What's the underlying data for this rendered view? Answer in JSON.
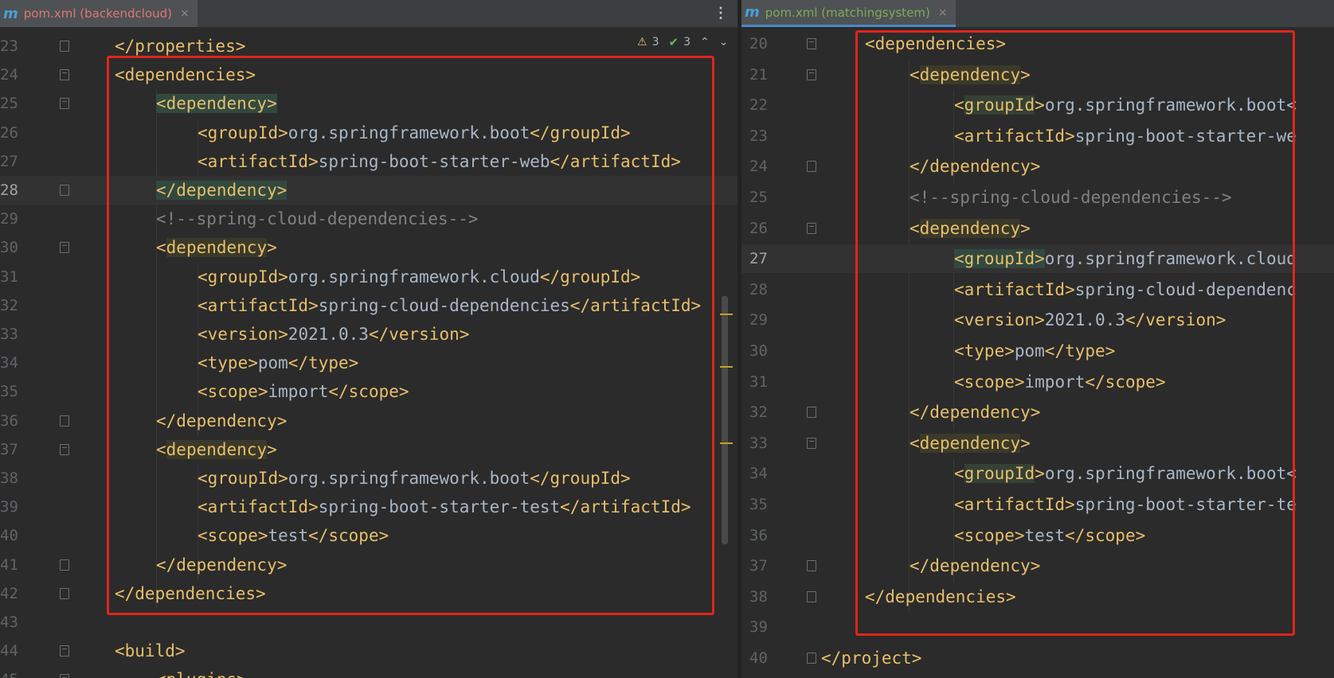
{
  "left": {
    "tab": {
      "icon": "maven-m-icon",
      "glyph": "m",
      "label": "pom.xml (backendcloud)",
      "close": "×"
    },
    "more_glyph": "⋮",
    "indicators": {
      "warning_icon": "⚠",
      "warnings": "3",
      "ok_icon": "✔",
      "ok": "3",
      "up": "⌃",
      "down": "⌄"
    },
    "lines": [
      {
        "n": "23",
        "code": [
          {
            "t": "</properties>",
            "c": "tag"
          }
        ]
      },
      {
        "n": "24",
        "code": [
          {
            "t": "<dependencies>",
            "c": "tag"
          }
        ]
      },
      {
        "n": "25",
        "code": [
          {
            "t": "<dependency>",
            "c": "tag hl-teal"
          }
        ]
      },
      {
        "n": "26",
        "code": [
          {
            "t": "<groupId>",
            "c": "tag"
          },
          {
            "t": "org.springframework.boot",
            "c": "txt"
          },
          {
            "t": "</groupId>",
            "c": "tag"
          }
        ]
      },
      {
        "n": "27",
        "code": [
          {
            "t": "<artifactId>",
            "c": "tag"
          },
          {
            "t": "spring-boot-starter-web",
            "c": "txt"
          },
          {
            "t": "</artifactId>",
            "c": "tag"
          }
        ]
      },
      {
        "n": "28",
        "code": [
          {
            "t": "</dependency>",
            "c": "tag hl-teal"
          }
        ]
      },
      {
        "n": "29",
        "code": [
          {
            "t": "<!--spring-cloud-dependencies-->",
            "c": "cmt"
          }
        ]
      },
      {
        "n": "30",
        "code": [
          {
            "t": "<",
            "c": "tag"
          },
          {
            "t": "dependency",
            "c": "tag hl-olive"
          },
          {
            "t": ">",
            "c": "tag"
          }
        ]
      },
      {
        "n": "31",
        "code": [
          {
            "t": "<groupId>",
            "c": "tag"
          },
          {
            "t": "org.springframework.cloud",
            "c": "txt"
          },
          {
            "t": "</groupId>",
            "c": "tag"
          }
        ]
      },
      {
        "n": "32",
        "code": [
          {
            "t": "<artifactId>",
            "c": "tag"
          },
          {
            "t": "spring-cloud-dependencies",
            "c": "txt"
          },
          {
            "t": "</artifactId>",
            "c": "tag"
          }
        ]
      },
      {
        "n": "33",
        "code": [
          {
            "t": "<version>",
            "c": "tag"
          },
          {
            "t": "2021.0.3",
            "c": "txt"
          },
          {
            "t": "</version>",
            "c": "tag"
          }
        ]
      },
      {
        "n": "34",
        "code": [
          {
            "t": "<type>",
            "c": "tag"
          },
          {
            "t": "pom",
            "c": "txt"
          },
          {
            "t": "</type>",
            "c": "tag"
          }
        ]
      },
      {
        "n": "35",
        "code": [
          {
            "t": "<scope>",
            "c": "tag"
          },
          {
            "t": "import",
            "c": "txt"
          },
          {
            "t": "</scope>",
            "c": "tag"
          }
        ]
      },
      {
        "n": "36",
        "code": [
          {
            "t": "</dependency>",
            "c": "tag"
          }
        ]
      },
      {
        "n": "37",
        "code": [
          {
            "t": "<",
            "c": "tag"
          },
          {
            "t": "dependency",
            "c": "tag hl-olive"
          },
          {
            "t": ">",
            "c": "tag"
          }
        ]
      },
      {
        "n": "38",
        "code": [
          {
            "t": "<groupId>",
            "c": "tag"
          },
          {
            "t": "org.springframework.boot",
            "c": "txt"
          },
          {
            "t": "</groupId>",
            "c": "tag"
          }
        ]
      },
      {
        "n": "39",
        "code": [
          {
            "t": "<artifactId>",
            "c": "tag"
          },
          {
            "t": "spring-boot-starter-test",
            "c": "txt"
          },
          {
            "t": "</artifactId>",
            "c": "tag"
          }
        ]
      },
      {
        "n": "40",
        "code": [
          {
            "t": "<scope>",
            "c": "tag"
          },
          {
            "t": "test",
            "c": "txt"
          },
          {
            "t": "</scope>",
            "c": "tag"
          }
        ]
      },
      {
        "n": "41",
        "code": [
          {
            "t": "</dependency>",
            "c": "tag"
          }
        ]
      },
      {
        "n": "42",
        "code": [
          {
            "t": "</dependencies>",
            "c": "tag"
          }
        ]
      },
      {
        "n": "43",
        "code": []
      },
      {
        "n": "44",
        "code": [
          {
            "t": "<build>",
            "c": "tag"
          }
        ]
      },
      {
        "n": "45",
        "code": [
          {
            "t": "<plugins>",
            "c": "tag"
          }
        ]
      }
    ]
  },
  "right": {
    "tab": {
      "icon": "maven-m-icon",
      "glyph": "m",
      "label": "pom.xml (matchingsystem)",
      "close": "×"
    },
    "lines": [
      {
        "n": "20",
        "code": [
          {
            "t": "<dependencies>",
            "c": "tag"
          }
        ]
      },
      {
        "n": "21",
        "code": [
          {
            "t": "<",
            "c": "tag"
          },
          {
            "t": "dependency",
            "c": "tag hl-olive"
          },
          {
            "t": ">",
            "c": "tag"
          }
        ]
      },
      {
        "n": "22",
        "code": [
          {
            "t": "<",
            "c": "tag"
          },
          {
            "t": "groupId",
            "c": "tag hl-green"
          },
          {
            "t": ">",
            "c": "tag"
          },
          {
            "t": "org.springframework.boot<",
            "c": "txt"
          }
        ]
      },
      {
        "n": "23",
        "code": [
          {
            "t": "<artifactId>",
            "c": "tag"
          },
          {
            "t": "spring-boot-starter-we",
            "c": "txt"
          }
        ]
      },
      {
        "n": "24",
        "code": [
          {
            "t": "</dependency>",
            "c": "tag"
          }
        ]
      },
      {
        "n": "25",
        "code": [
          {
            "t": "<!--spring-cloud-dependencies-->",
            "c": "cmt"
          }
        ]
      },
      {
        "n": "26",
        "code": [
          {
            "t": "<",
            "c": "tag"
          },
          {
            "t": "dependency",
            "c": "tag hl-olive"
          },
          {
            "t": ">",
            "c": "tag"
          }
        ]
      },
      {
        "n": "27",
        "code": [
          {
            "t": "<groupId>",
            "c": "tag hl-teal"
          },
          {
            "t": "org.springframework.cloud",
            "c": "txt"
          }
        ]
      },
      {
        "n": "28",
        "code": [
          {
            "t": "<artifactId>",
            "c": "tag"
          },
          {
            "t": "spring-cloud-dependenc",
            "c": "txt"
          }
        ]
      },
      {
        "n": "29",
        "code": [
          {
            "t": "<version>",
            "c": "tag"
          },
          {
            "t": "2021.0.3",
            "c": "txt"
          },
          {
            "t": "</version>",
            "c": "tag"
          }
        ]
      },
      {
        "n": "30",
        "code": [
          {
            "t": "<type>",
            "c": "tag"
          },
          {
            "t": "pom",
            "c": "txt"
          },
          {
            "t": "</type>",
            "c": "tag"
          }
        ]
      },
      {
        "n": "31",
        "code": [
          {
            "t": "<scope>",
            "c": "tag"
          },
          {
            "t": "import",
            "c": "txt"
          },
          {
            "t": "</scope>",
            "c": "tag"
          }
        ]
      },
      {
        "n": "32",
        "code": [
          {
            "t": "</dependency>",
            "c": "tag"
          }
        ]
      },
      {
        "n": "33",
        "code": [
          {
            "t": "<",
            "c": "tag"
          },
          {
            "t": "dependency",
            "c": "tag hl-olive"
          },
          {
            "t": ">",
            "c": "tag"
          }
        ]
      },
      {
        "n": "34",
        "code": [
          {
            "t": "<",
            "c": "tag"
          },
          {
            "t": "groupId",
            "c": "tag hl-green"
          },
          {
            "t": ">",
            "c": "tag"
          },
          {
            "t": "org.springframework.boot<",
            "c": "txt"
          }
        ]
      },
      {
        "n": "35",
        "code": [
          {
            "t": "<artifactId>",
            "c": "tag"
          },
          {
            "t": "spring-boot-starter-te",
            "c": "txt"
          }
        ]
      },
      {
        "n": "36",
        "code": [
          {
            "t": "<scope>",
            "c": "tag"
          },
          {
            "t": "test",
            "c": "txt"
          },
          {
            "t": "</scope>",
            "c": "tag"
          }
        ]
      },
      {
        "n": "37",
        "code": [
          {
            "t": "</dependency>",
            "c": "tag"
          }
        ]
      },
      {
        "n": "38",
        "code": [
          {
            "t": "</dependencies>",
            "c": "tag"
          }
        ]
      },
      {
        "n": "39",
        "code": []
      },
      {
        "n": "40",
        "code": [
          {
            "t": "</project>",
            "c": "tag"
          }
        ]
      }
    ]
  },
  "colors": {
    "tag": "#e8bf6a",
    "text": "#a9b7c6",
    "comment": "#808080",
    "highlight_box": "#e0251b",
    "tab_underline": "#4a88c7"
  }
}
